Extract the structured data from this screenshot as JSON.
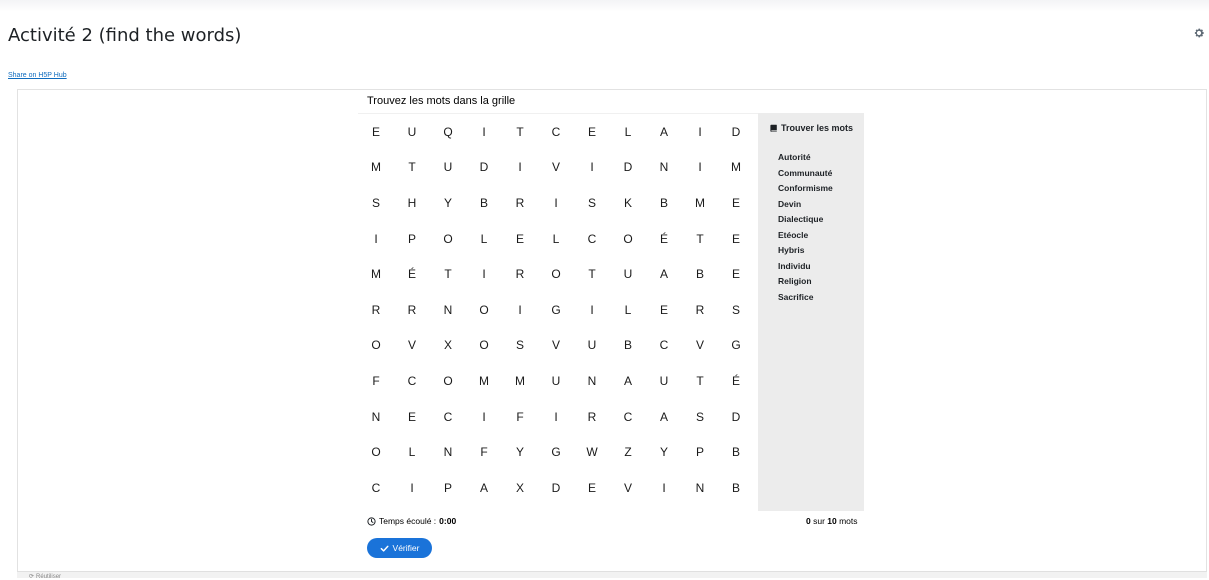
{
  "page": {
    "title": "Activité 2 (find the words)",
    "share_link": "Share on H5P Hub",
    "instructions": "Trouvez les mots dans la grille"
  },
  "grid": {
    "rows": [
      [
        "E",
        "U",
        "Q",
        "I",
        "T",
        "C",
        "E",
        "L",
        "A",
        "I",
        "D"
      ],
      [
        "M",
        "T",
        "U",
        "D",
        "I",
        "V",
        "I",
        "D",
        "N",
        "I",
        "M"
      ],
      [
        "S",
        "H",
        "Y",
        "B",
        "R",
        "I",
        "S",
        "K",
        "B",
        "M",
        "E"
      ],
      [
        "I",
        "P",
        "O",
        "L",
        "E",
        "L",
        "C",
        "O",
        "É",
        "T",
        "E"
      ],
      [
        "M",
        "É",
        "T",
        "I",
        "R",
        "O",
        "T",
        "U",
        "A",
        "B",
        "E"
      ],
      [
        "R",
        "R",
        "N",
        "O",
        "I",
        "G",
        "I",
        "L",
        "E",
        "R",
        "S"
      ],
      [
        "O",
        "V",
        "X",
        "O",
        "S",
        "V",
        "U",
        "B",
        "C",
        "V",
        "G"
      ],
      [
        "F",
        "C",
        "O",
        "M",
        "M",
        "U",
        "N",
        "A",
        "U",
        "T",
        "É"
      ],
      [
        "N",
        "E",
        "C",
        "I",
        "F",
        "I",
        "R",
        "C",
        "A",
        "S",
        "D"
      ],
      [
        "O",
        "L",
        "N",
        "F",
        "Y",
        "G",
        "W",
        "Z",
        "Y",
        "P",
        "B"
      ],
      [
        "C",
        "I",
        "P",
        "A",
        "X",
        "D",
        "E",
        "V",
        "I",
        "N",
        "B"
      ]
    ]
  },
  "sidebar": {
    "title": "Trouver les mots",
    "words": [
      "Autorité",
      "Communauté",
      "Conformisme",
      "Devin",
      "Dialectique",
      "Etéocle",
      "Hybris",
      "Individu",
      "Religion",
      "Sacrifice"
    ]
  },
  "footer": {
    "timer_label": "Temps écoulé : ",
    "timer_value": "0:00",
    "found": "0",
    "count_middle": " sur ",
    "total": "10",
    "count_suffix": " mots",
    "check_label": "Vérifier",
    "bottom_label": "Réutiliser"
  },
  "colors": {
    "accent": "#1a73d9",
    "link": "#0f6cbf",
    "sidebar_bg": "#ececec"
  },
  "icons": {
    "settings": "gear-icon",
    "word_list": "book-icon",
    "timer": "clock-icon",
    "check": "check-icon"
  }
}
